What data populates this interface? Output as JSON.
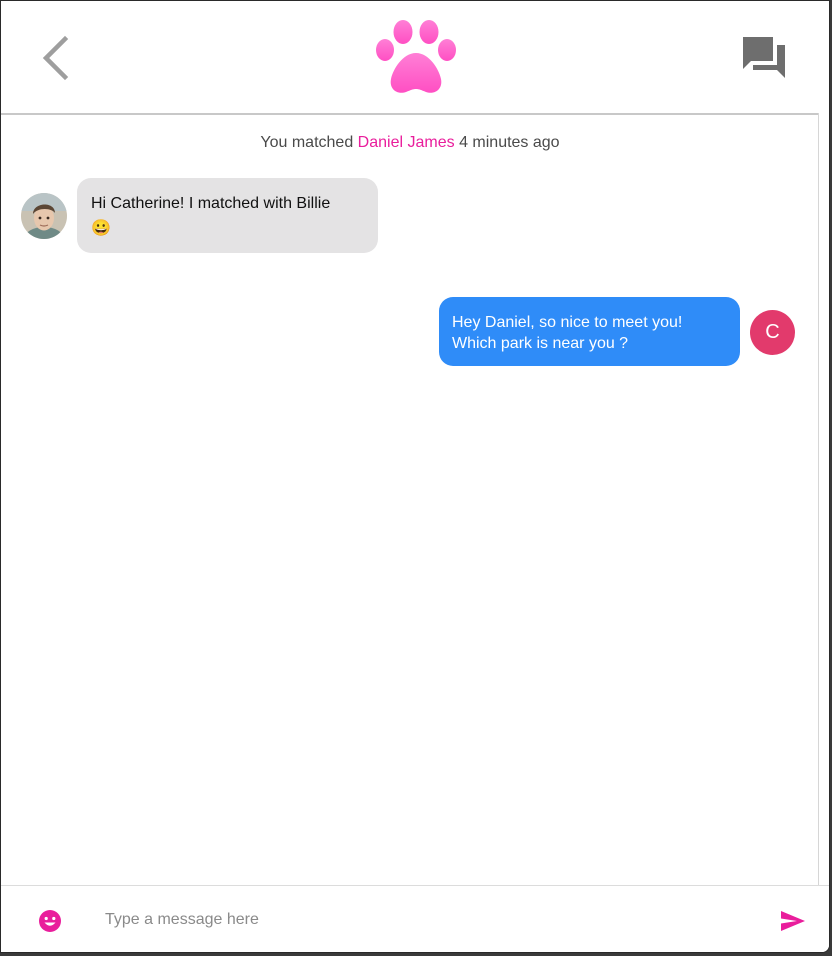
{
  "colors": {
    "accent": "#e91e9c",
    "incoming_bubble": "#e4e3e4",
    "outgoing_bubble": "#2f8cf8",
    "user_avatar": "#e23a6c",
    "icon_gray": "#9e9e9e",
    "chat_icon_gray": "#6e6e6e"
  },
  "header": {
    "back_icon": "chevron-left-icon",
    "logo_icon": "paw-print-icon",
    "chat_icon": "forum-icon"
  },
  "match_notice": {
    "prefix": "You matched",
    "name": "Daniel James",
    "suffix": "4 minutes ago"
  },
  "messages": [
    {
      "direction": "incoming",
      "text": "Hi Catherine! I matched with Billie",
      "emoji": "😀",
      "avatar": "photo"
    },
    {
      "direction": "outgoing",
      "line1": "Hey Daniel, so nice to meet you!",
      "line2": "Which park is near you ?",
      "avatar_letter": "C"
    }
  ],
  "composer": {
    "placeholder": "Type a message here",
    "value": "",
    "emoji_icon": "smiley-icon",
    "send_icon": "send-icon"
  }
}
